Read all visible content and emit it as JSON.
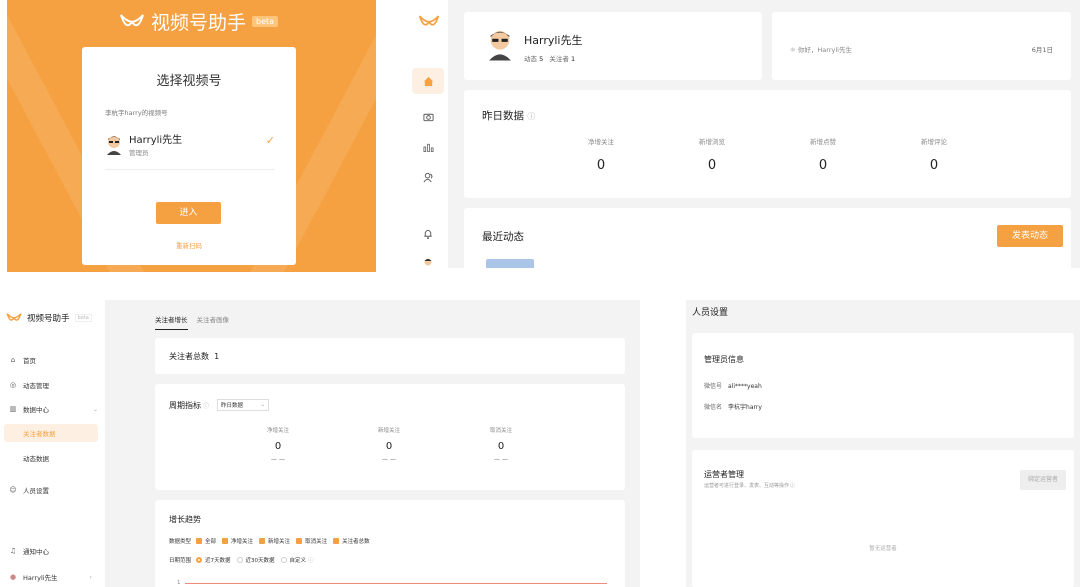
{
  "login": {
    "brand": "视频号助手",
    "beta": "beta",
    "title": "选择视频号",
    "account_label": "李杭宇harry的视频号",
    "account_name": "Harryli先生",
    "account_role": "管理员",
    "enter": "进入",
    "rescan": "重新扫码"
  },
  "home": {
    "user_name": "Harryli先生",
    "posts_label": "动态",
    "posts_value": "5",
    "followers_label": "关注者",
    "followers_value": "1",
    "greeting": "你好，Harryli先生",
    "date": "6月1日",
    "yesterday_title": "昨日数据",
    "metrics": [
      {
        "label": "净增关注",
        "value": "0"
      },
      {
        "label": "新增浏览",
        "value": "0"
      },
      {
        "label": "新增点赞",
        "value": "0"
      },
      {
        "label": "新增评论",
        "value": "0"
      }
    ],
    "recent_title": "最近动态",
    "publish": "发表动态"
  },
  "followers": {
    "brand": "视频号助手",
    "beta": "beta",
    "nav": [
      {
        "label": "首页",
        "icon": "house-icon"
      },
      {
        "label": "动态管理",
        "icon": "camera-icon"
      },
      {
        "label": "数据中心",
        "icon": "bar-chart-icon"
      },
      {
        "label": "关注者数据",
        "icon": ""
      },
      {
        "label": "动态数据",
        "icon": ""
      },
      {
        "label": "人员设置",
        "icon": "people-icon"
      }
    ],
    "bottom_nav": [
      {
        "label": "通知中心",
        "icon": "bell-icon"
      },
      {
        "label": "Harryli先生",
        "icon": "avatar-icon"
      }
    ],
    "tabs": [
      "关注者增长",
      "关注者画像"
    ],
    "total_label": "关注者总数",
    "total_value": "1",
    "cycle_title": "周期指标",
    "cycle_select": "昨日数据",
    "cycle_metrics": [
      {
        "label": "净增关注",
        "value": "0",
        "delta": "— —"
      },
      {
        "label": "新增关注",
        "value": "0",
        "delta": "— —"
      },
      {
        "label": "取消关注",
        "value": "0",
        "delta": "— —"
      }
    ],
    "trend_title": "增长趋势",
    "data_type_label": "数据类型",
    "data_types": [
      "全部",
      "净增关注",
      "新增关注",
      "取消关注",
      "关注者总数"
    ],
    "date_range_label": "日期范围",
    "date_ranges": [
      "近7天数据",
      "近30天数据",
      "自定义"
    ],
    "chart_y": "1"
  },
  "personnel": {
    "title": "人员设置",
    "admin_title": "管理员信息",
    "wechat_label": "微信号",
    "wechat_value": "ali****yeah",
    "nickname_label": "微信名",
    "nickname_value": "李杭宇harry",
    "operator_title": "运营者管理",
    "operator_desc": "运营者可进行登录、发表、互动等操作",
    "bind_button": "绑定运营者",
    "empty": "暂无运营者"
  },
  "colors": {
    "accent": "#f5a141",
    "accent_light": "#fdf0e3",
    "bg": "#f3f3f3"
  }
}
